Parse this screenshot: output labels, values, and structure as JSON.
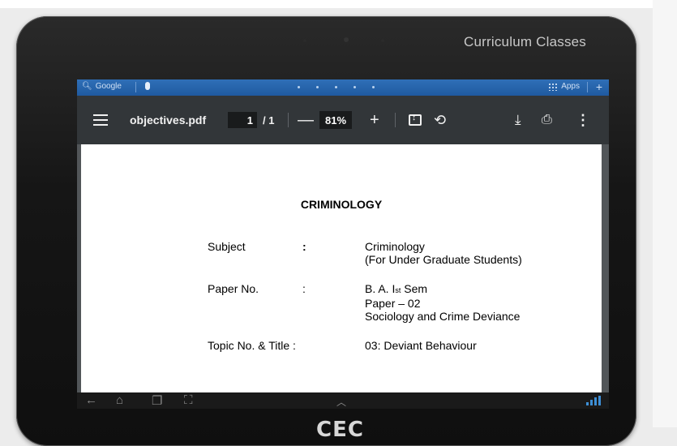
{
  "tablet": {
    "brand": "Curriculum Classes",
    "logo": "CEC"
  },
  "statusbar": {
    "search_label": "Google",
    "apps_label": "Apps"
  },
  "viewer": {
    "filename": "objectives.pdf",
    "page_current": "1",
    "page_total": "/ 1",
    "zoom": "81%"
  },
  "document": {
    "title": "CRIMINOLOGY",
    "rows": [
      {
        "label": "Subject",
        "colon": ":",
        "values": [
          "Criminology",
          "(For Under Graduate Students)"
        ]
      },
      {
        "label": "Paper No.",
        "colon": ":",
        "values": [
          "Paper – 02",
          "Sociology and Crime Deviance"
        ]
      },
      {
        "label": "Topic No. & Title :",
        "colon": "",
        "values": [
          "03: Deviant Behaviour"
        ]
      }
    ],
    "paper_line_prefix": "B. A. I",
    "paper_line_sup": "st",
    "paper_line_suffix": " Sem"
  },
  "colors": {
    "toolbar": "#323639",
    "statusbar": "#1f5aa0",
    "doc_bg": "#525659"
  }
}
